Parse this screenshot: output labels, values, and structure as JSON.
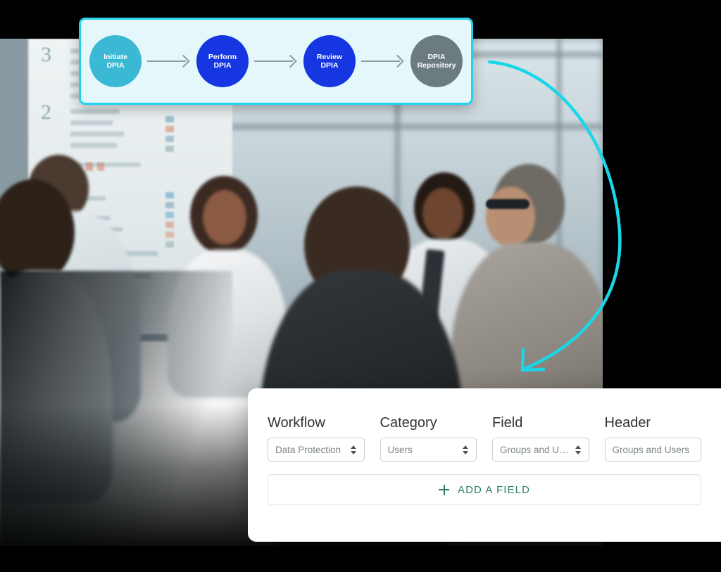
{
  "background": {
    "canvas_color": "#000000",
    "photo_description": "blurred photo of a business meeting around a white table"
  },
  "workflow_card": {
    "border_color": "#22d3ee",
    "fill_color": "#e4f7fb",
    "nodes": [
      {
        "label_line1": "Initiate",
        "label_line2": "DPIA",
        "color": "#3bb8d4"
      },
      {
        "label_line1": "Perform",
        "label_line2": "DPIA",
        "color": "#1536e0"
      },
      {
        "label_line1": "Review",
        "label_line2": "DPIA",
        "color": "#1536e0"
      },
      {
        "label_line1": "DPIA",
        "label_line2": "Repository",
        "color": "#6b7b80"
      }
    ],
    "connector_color": "#8f9aa3"
  },
  "annotation": {
    "arrow_name": "curved-pointer-arrow",
    "color": "#1ad7e8"
  },
  "form_panel": {
    "fields": [
      {
        "label": "Workflow",
        "control": "select",
        "value": "Data Protection"
      },
      {
        "label": "Category",
        "control": "select",
        "value": "Users"
      },
      {
        "label": "Field",
        "control": "select",
        "value": "Groups and Users"
      },
      {
        "label": "Header",
        "control": "text",
        "value": "Groups and Users",
        "placeholder": "Groups and Users"
      }
    ],
    "add_field_label": "ADD A FIELD",
    "accent_color": "#2e7d6b"
  }
}
